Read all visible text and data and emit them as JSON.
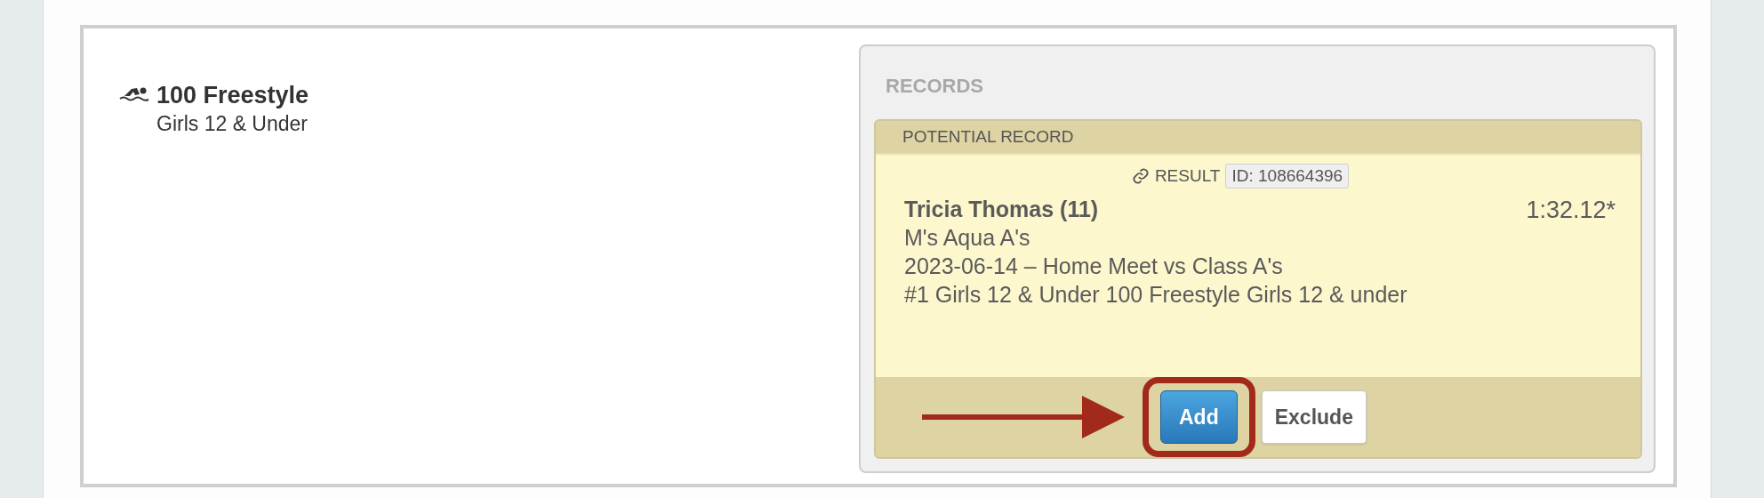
{
  "event": {
    "title": "100 Freestyle",
    "subtitle": "Girls 12 & Under"
  },
  "records": {
    "heading": "RECORDS",
    "card": {
      "header": "POTENTIAL RECORD",
      "result_label": "RESULT",
      "result_id": "ID: 108664396",
      "swimmer": "Tricia Thomas (11)",
      "team": "M's Aqua A's",
      "meet": "2023-06-14 – Home Meet vs Class A's",
      "event": "#1 Girls 12 & Under 100 Freestyle Girls 12 & under",
      "time": "1:32.12*"
    },
    "buttons": [
      {
        "label": "Add",
        "kind": "primary",
        "highlighted": true
      },
      {
        "label": "Exclude",
        "kind": "secondary",
        "highlighted": false
      }
    ]
  }
}
